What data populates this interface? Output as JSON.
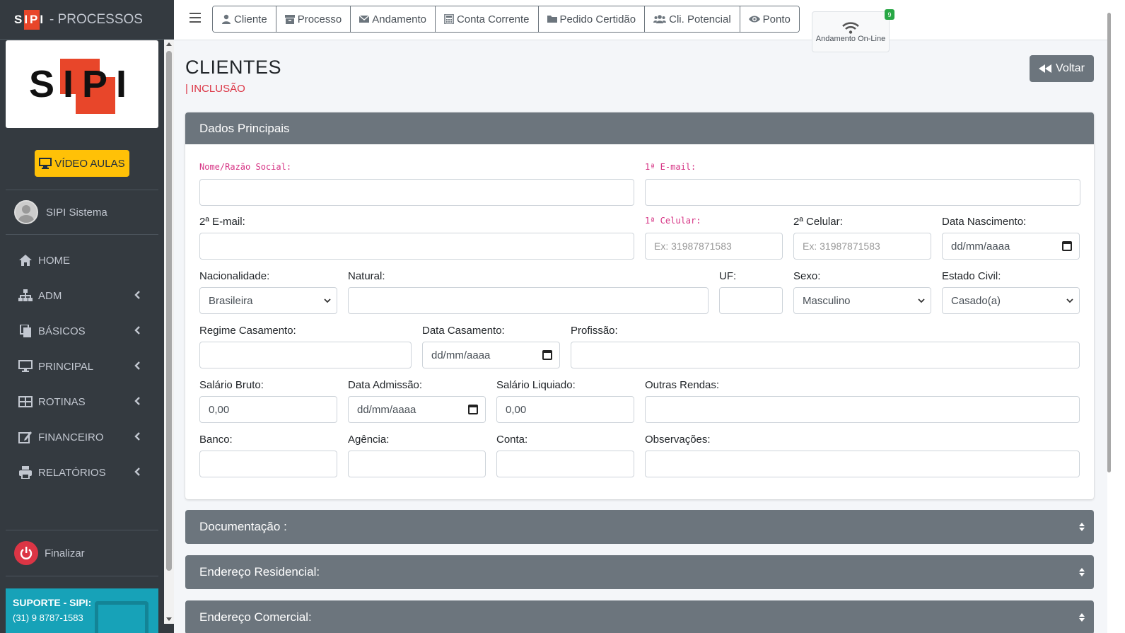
{
  "brand": {
    "logo_text": "SIPI",
    "title": "- PROCESSOS"
  },
  "sidebar": {
    "logo_text": "SIPI",
    "video_button": "VÍDEO AULAS",
    "user_name": "SIPI Sistema",
    "items": [
      {
        "label": "HOME",
        "icon": "home-icon"
      },
      {
        "label": "ADM",
        "icon": "sitemap-icon"
      },
      {
        "label": "BÁSICOS",
        "icon": "copy-icon"
      },
      {
        "label": "PRINCIPAL",
        "icon": "desktop-icon"
      },
      {
        "label": "ROTINAS",
        "icon": "table-icon"
      },
      {
        "label": "FINANCEIRO",
        "icon": "edit-icon"
      },
      {
        "label": "RELATÓRIOS",
        "icon": "print-icon"
      }
    ],
    "logout": "Finalizar",
    "support_title": "SUPORTE - SIPI:",
    "support_phone": "(31) 9 8787-1583"
  },
  "topnav": {
    "buttons": [
      {
        "label": "Cliente",
        "icon": "user-icon"
      },
      {
        "label": "Processo",
        "icon": "archive-icon"
      },
      {
        "label": "Andamento",
        "icon": "envelope-icon"
      },
      {
        "label": "Conta Corrente",
        "icon": "calculator-icon"
      },
      {
        "label": "Pedido Certidão",
        "icon": "folder-icon"
      },
      {
        "label": "Cli. Potencial",
        "icon": "users-icon"
      },
      {
        "label": "Ponto",
        "icon": "eye-icon"
      }
    ],
    "online_label": "Andamento On-Line",
    "online_badge": "9"
  },
  "page": {
    "title": "CLIENTES",
    "subtitle": "| INCLUSÃO",
    "back_button": "Voltar"
  },
  "form": {
    "header": "Dados Principais",
    "nome_label": "Nome/Razão Social:",
    "email1_label": "1ª E-mail:",
    "email2_label": "2ª E-mail:",
    "cel1_label": "1ª Celular:",
    "cel1_placeholder": "Ex: 31987871583",
    "cel2_label": "2ª Celular:",
    "cel2_placeholder": "Ex: 31987871583",
    "nasc_label": "Data Nascimento:",
    "date_placeholder": "dd/mm/aaaa",
    "nac_label": "Nacionalidade:",
    "nac_value": "Brasileira",
    "natural_label": "Natural:",
    "uf_label": "UF:",
    "sexo_label": "Sexo:",
    "sexo_value": "Masculino",
    "civil_label": "Estado Civil:",
    "civil_value": "Casado(a)",
    "regime_label": "Regime Casamento:",
    "dtcas_label": "Data Casamento:",
    "prof_label": "Profissão:",
    "sal_bruto_label": "Salário Bruto:",
    "sal_bruto_value": "0,00",
    "dtadm_label": "Data Admissão:",
    "sal_liq_label": "Salário Liquiado:",
    "sal_liq_value": "0,00",
    "outras_label": "Outras Rendas:",
    "banco_label": "Banco:",
    "agencia_label": "Agência:",
    "conta_label": "Conta:",
    "obs_label": "Observações:"
  },
  "sections": [
    "Documentação :",
    "Endereço Residencial:",
    "Endereço Comercial:"
  ]
}
